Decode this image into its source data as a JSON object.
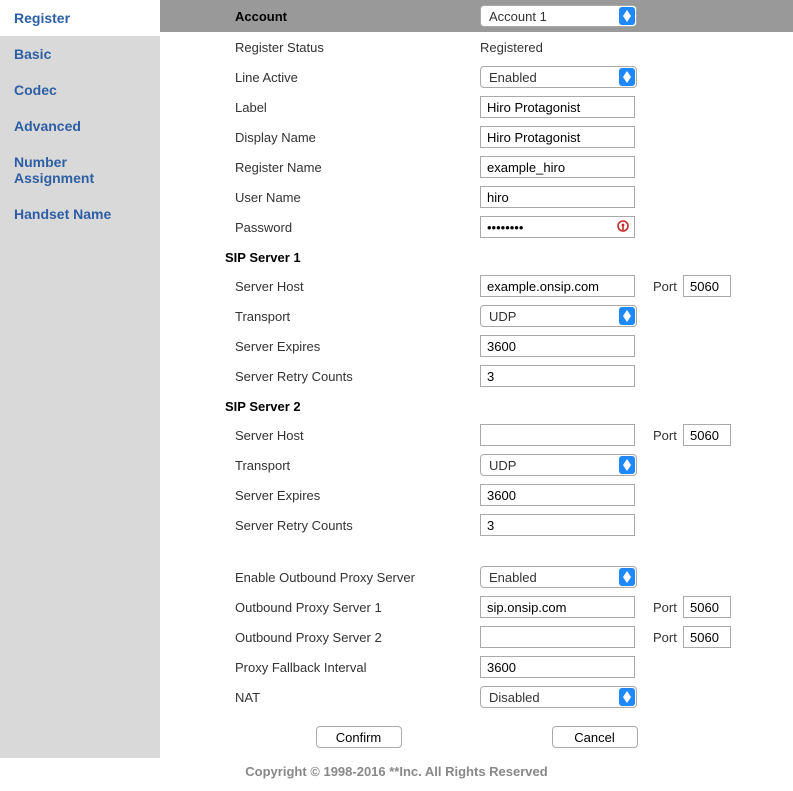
{
  "sidebar": {
    "items": [
      {
        "label": "Register",
        "active": true
      },
      {
        "label": "Basic"
      },
      {
        "label": "Codec"
      },
      {
        "label": "Advanced"
      },
      {
        "label": "Number Assignment"
      },
      {
        "label": "Handset Name"
      }
    ]
  },
  "header": {
    "account_label": "Account",
    "account_value": "Account 1"
  },
  "fields": {
    "register_status_label": "Register Status",
    "register_status_value": "Registered",
    "line_active_label": "Line Active",
    "line_active_value": "Enabled",
    "label_label": "Label",
    "label_value": "Hiro Protagonist",
    "display_name_label": "Display Name",
    "display_name_value": "Hiro Protagonist",
    "register_name_label": "Register Name",
    "register_name_value": "example_hiro",
    "user_name_label": "User Name",
    "user_name_value": "hiro",
    "password_label": "Password",
    "password_value": "••••••••"
  },
  "sip1": {
    "title": "SIP Server 1",
    "server_host_label": "Server Host",
    "server_host_value": "example.onsip.com",
    "port_label": "Port",
    "port_value": "5060",
    "transport_label": "Transport",
    "transport_value": "UDP",
    "server_expires_label": "Server Expires",
    "server_expires_value": "3600",
    "server_retry_label": "Server Retry Counts",
    "server_retry_value": "3"
  },
  "sip2": {
    "title": "SIP Server 2",
    "server_host_label": "Server Host",
    "server_host_value": "",
    "port_label": "Port",
    "port_value": "5060",
    "transport_label": "Transport",
    "transport_value": "UDP",
    "server_expires_label": "Server Expires",
    "server_expires_value": "3600",
    "server_retry_label": "Server Retry Counts",
    "server_retry_value": "3"
  },
  "proxy": {
    "enable_label": "Enable Outbound Proxy Server",
    "enable_value": "Enabled",
    "server1_label": "Outbound Proxy Server 1",
    "server1_value": "sip.onsip.com",
    "server1_port_label": "Port",
    "server1_port_value": "5060",
    "server2_label": "Outbound Proxy Server 2",
    "server2_value": "",
    "server2_port_label": "Port",
    "server2_port_value": "5060",
    "fallback_label": "Proxy Fallback Interval",
    "fallback_value": "3600",
    "nat_label": "NAT",
    "nat_value": "Disabled"
  },
  "buttons": {
    "confirm": "Confirm",
    "cancel": "Cancel"
  },
  "footer": "Copyright © 1998-2016 **Inc. All Rights Reserved"
}
